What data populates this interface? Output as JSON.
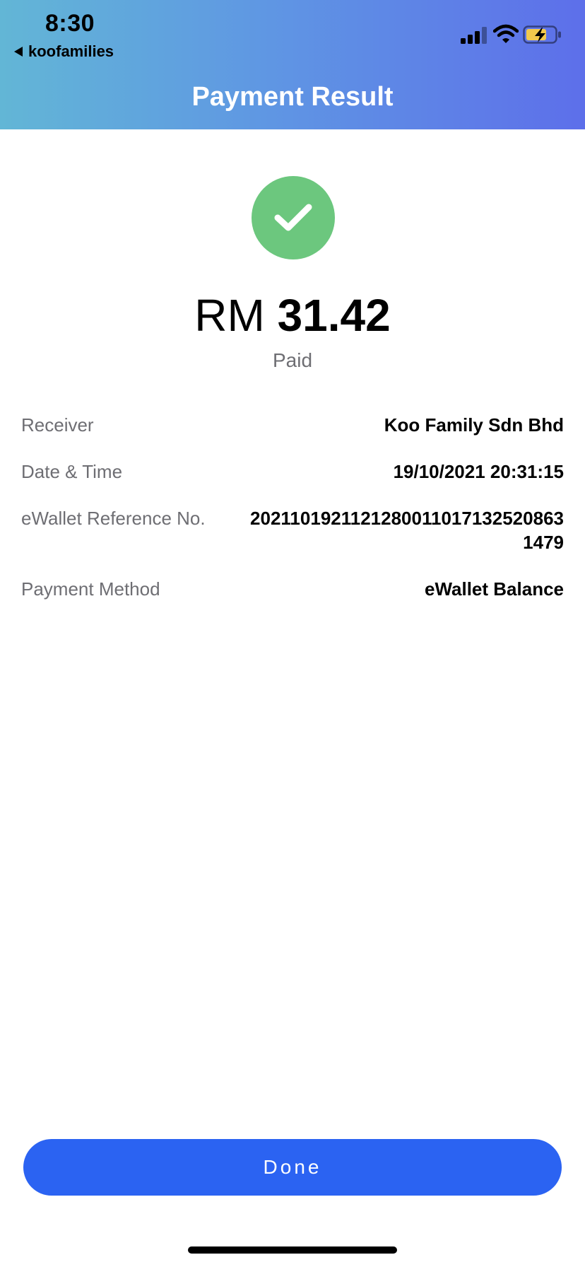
{
  "status_bar": {
    "time": "8:30",
    "back_app": "koofamilies",
    "icons": [
      "signal-icon",
      "wifi-icon",
      "battery-charging-icon"
    ]
  },
  "header": {
    "title": "Payment Result"
  },
  "result": {
    "icon": "check-icon",
    "currency": "RM",
    "amount": "31.42",
    "status": "Paid"
  },
  "details": {
    "receiver_label": "Receiver",
    "receiver_value": "Koo Family Sdn Bhd",
    "datetime_label": "Date & Time",
    "datetime_value": "19/10/2021 20:31:15",
    "reference_label": "eWallet Reference No.",
    "reference_value": "20211019211212800110171325208631479",
    "method_label": "Payment Method",
    "method_value": "eWallet Balance"
  },
  "actions": {
    "done_label": "Done"
  },
  "colors": {
    "header_gradient_start": "#62b6d6",
    "header_gradient_end": "#5d6fea",
    "success_green": "#6cc77e",
    "button_blue": "#2b63f2",
    "label_gray": "#6e6e73"
  }
}
